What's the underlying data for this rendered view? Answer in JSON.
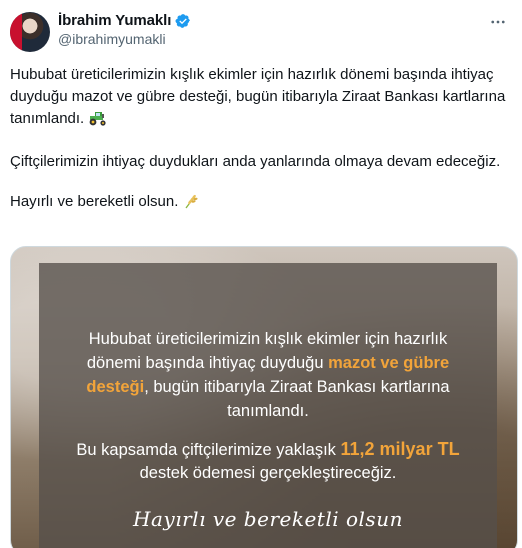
{
  "author": {
    "name": "İbrahim Yumaklı",
    "handle": "@ibrahimyumakli",
    "verified": true,
    "avatar_icon": "profile-photo"
  },
  "tweet": {
    "para1_text": "Hububat üreticilerimizin kışlık ekimler için hazırlık dönemi başında ihtiyaç duyduğu mazot ve gübre desteği, bugün itibarıyla Ziraat Bankası kartlarına tanımlandı.",
    "para1_emoji": "tractor-icon",
    "para2": "Çiftçilerimizin ihtiyaç duydukları anda yanlarında olmaya devam edeceğiz.",
    "para3_text": "Hayırlı ve bereketli olsun.",
    "para3_emoji": "wheat-icon"
  },
  "media": {
    "line1": "Hububat üreticilerimizin kışlık ekimler için hazırlık",
    "line2_a": "dönemi başında ihtiyaç duyduğu ",
    "line2_hl": "mazot ve gübre",
    "line3_hl": "desteği",
    "line3_b": ", bugün itibarıyla Ziraat Bankası kartlarına",
    "line4": "tanımlandı.",
    "line5_a": "Bu kapsamda çiftçilerimize yaklaşık ",
    "line5_hl": "11,2 milyar TL",
    "line6": "destek ödemesi gerçekleştireceğiz.",
    "signature": "Hayırlı ve bereketli olsun"
  },
  "colors": {
    "accent_orange": "#f2a43a",
    "verified_blue": "#1d9bf0",
    "handle_gray": "#536471"
  }
}
